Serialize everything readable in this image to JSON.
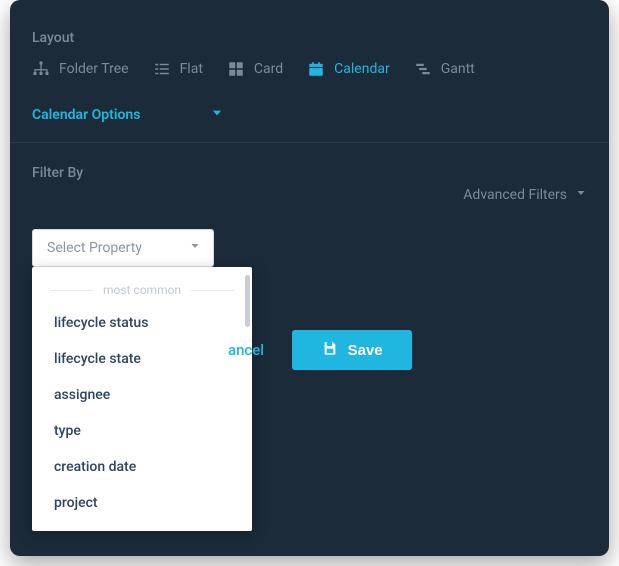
{
  "section_layout_label": "Layout",
  "layout_items": [
    {
      "label": "Folder Tree"
    },
    {
      "label": "Flat"
    },
    {
      "label": "Card"
    },
    {
      "label": "Calendar"
    },
    {
      "label": "Gantt"
    }
  ],
  "calendar_options_label": "Calendar Options",
  "filter_by_label": "Filter By",
  "advanced_filters_label": "Advanced Filters",
  "select": {
    "placeholder": "Select Property",
    "group_header": "most common",
    "options": [
      "lifecycle status",
      "lifecycle state",
      "assignee",
      "type",
      "creation date",
      "project"
    ]
  },
  "buttons": {
    "cancel": "ancel",
    "save": "Save"
  },
  "colors": {
    "accent": "#1fb6e0",
    "panel_bg": "#1b2b3a",
    "muted": "#7b8a99"
  }
}
